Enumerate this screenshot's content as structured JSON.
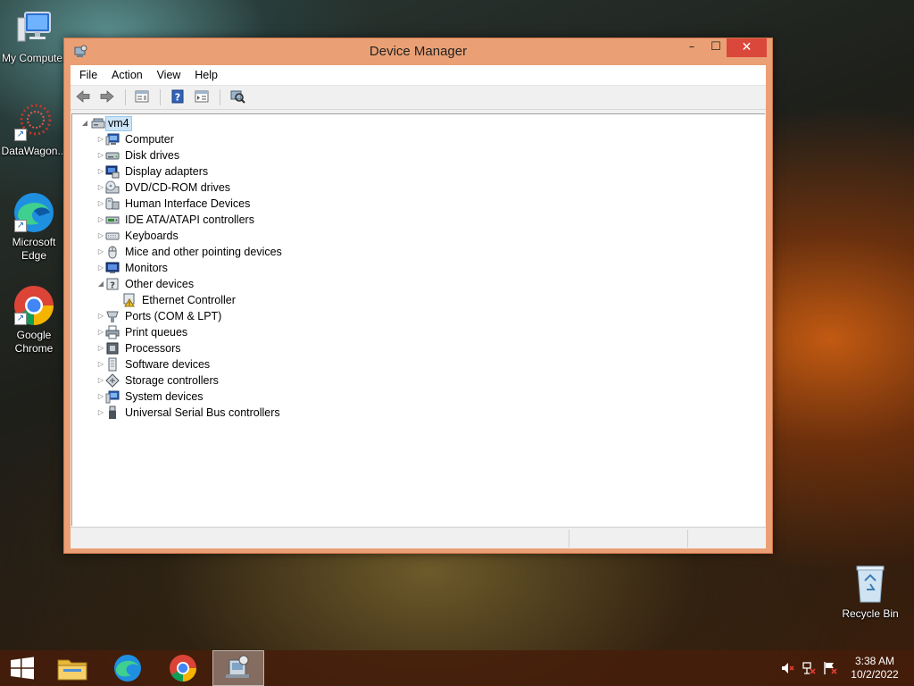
{
  "desktop": {
    "icons": [
      {
        "label": "My Computer"
      },
      {
        "label": "DataWagon..."
      },
      {
        "label": "Microsoft Edge"
      },
      {
        "label": "Google Chrome"
      },
      {
        "label": "Recycle Bin"
      }
    ]
  },
  "window": {
    "title": "Device Manager",
    "controls": {
      "minimize": "–",
      "maximize": "☐",
      "close": "✕"
    },
    "menu": [
      "File",
      "Action",
      "View",
      "Help"
    ],
    "toolbar": [
      "back",
      "forward",
      "properties",
      "help",
      "show-hidden",
      "scan-for-hardware-changes"
    ],
    "tree": {
      "root": "vm4",
      "categories": [
        {
          "label": "Computer",
          "icon": "computer-icon",
          "expanded": false
        },
        {
          "label": "Disk drives",
          "icon": "disk-drive-icon",
          "expanded": false
        },
        {
          "label": "Display adapters",
          "icon": "display-adapter-icon",
          "expanded": false
        },
        {
          "label": "DVD/CD-ROM drives",
          "icon": "dvd-drive-icon",
          "expanded": false
        },
        {
          "label": "Human Interface Devices",
          "icon": "hid-icon",
          "expanded": false
        },
        {
          "label": "IDE ATA/ATAPI controllers",
          "icon": "ide-controller-icon",
          "expanded": false
        },
        {
          "label": "Keyboards",
          "icon": "keyboard-icon",
          "expanded": false
        },
        {
          "label": "Mice and other pointing devices",
          "icon": "mouse-icon",
          "expanded": false
        },
        {
          "label": "Monitors",
          "icon": "monitor-icon",
          "expanded": false
        },
        {
          "label": "Other devices",
          "icon": "other-devices-icon",
          "expanded": true,
          "children": [
            {
              "label": "Ethernet Controller",
              "icon": "warning-device-icon"
            }
          ]
        },
        {
          "label": "Ports (COM & LPT)",
          "icon": "port-icon",
          "expanded": false
        },
        {
          "label": "Print queues",
          "icon": "printer-icon",
          "expanded": false
        },
        {
          "label": "Processors",
          "icon": "processor-icon",
          "expanded": false
        },
        {
          "label": "Software devices",
          "icon": "software-device-icon",
          "expanded": false
        },
        {
          "label": "Storage controllers",
          "icon": "storage-controller-icon",
          "expanded": false
        },
        {
          "label": "System devices",
          "icon": "system-device-icon",
          "expanded": false
        },
        {
          "label": "Universal Serial Bus controllers",
          "icon": "usb-icon",
          "expanded": false
        }
      ]
    }
  },
  "taskbar": {
    "apps": [
      "start",
      "file-explorer",
      "microsoft-edge",
      "google-chrome",
      "device-manager"
    ],
    "tray": [
      "volume-muted-icon",
      "network-icon",
      "action-center-flag-icon"
    ],
    "time": "3:38 AM",
    "date": "10/2/2022"
  },
  "colors": {
    "window_frame": "#eaa074",
    "close_button": "#d9483b",
    "selection": "#cce4f7"
  }
}
